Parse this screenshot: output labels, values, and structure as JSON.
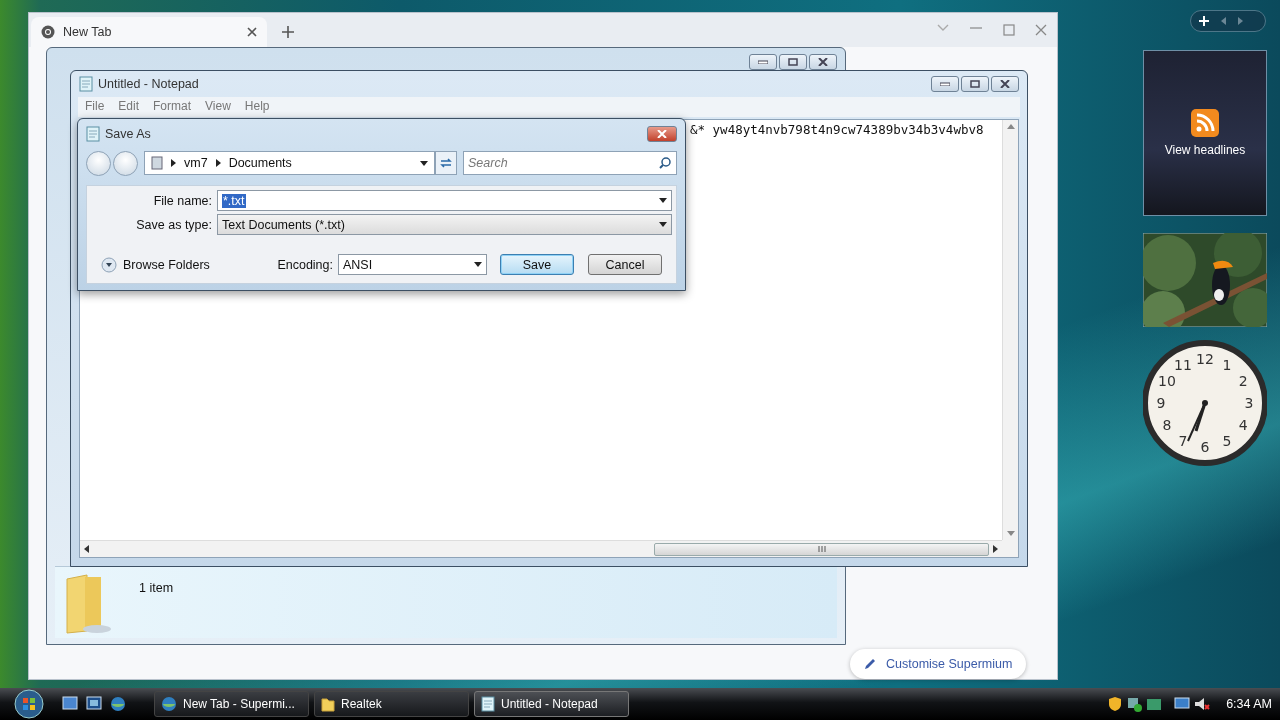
{
  "browser": {
    "tab": {
      "title": "New Tab"
    },
    "customise_button": "Customise Supermium"
  },
  "explorer": {
    "status": "1 item"
  },
  "notepad": {
    "title": "Untitled - Notepad",
    "menu": [
      "File",
      "Edit",
      "Format",
      "View",
      "Help"
    ],
    "text": "&* yw48yt4nvb798t4n9cw74389bv34b3v4wbv8"
  },
  "save_dialog": {
    "title": "Save As",
    "breadcrumb": [
      "vm7",
      "Documents"
    ],
    "search": {
      "placeholder": "Search"
    },
    "file_name": {
      "label": "File name:",
      "value": "*.txt",
      "text_selected": true
    },
    "save_as_type": {
      "label": "Save as type:",
      "value": "Text Documents (*.txt)"
    },
    "browse_folders": "Browse Folders",
    "encoding": {
      "label": "Encoding:",
      "value": "ANSI"
    },
    "buttons": [
      {
        "label": "Save",
        "default": true
      },
      {
        "label": "Cancel",
        "default": false
      }
    ]
  },
  "gadgets": {
    "feed": "View headlines",
    "clock": {
      "numerals": [
        "12",
        "11",
        "1",
        "10",
        "2",
        "9",
        "3",
        "8",
        "4",
        "7",
        "5",
        "6"
      ]
    }
  },
  "taskbar": {
    "tasks": [
      {
        "label": "New Tab - Supermi...",
        "kind": "browser",
        "selected": false
      },
      {
        "label": "Realtek",
        "kind": "folder",
        "selected": false
      },
      {
        "label": "Untitled - Notepad",
        "kind": "notepad",
        "selected": true
      }
    ],
    "time": "6:34 AM"
  }
}
